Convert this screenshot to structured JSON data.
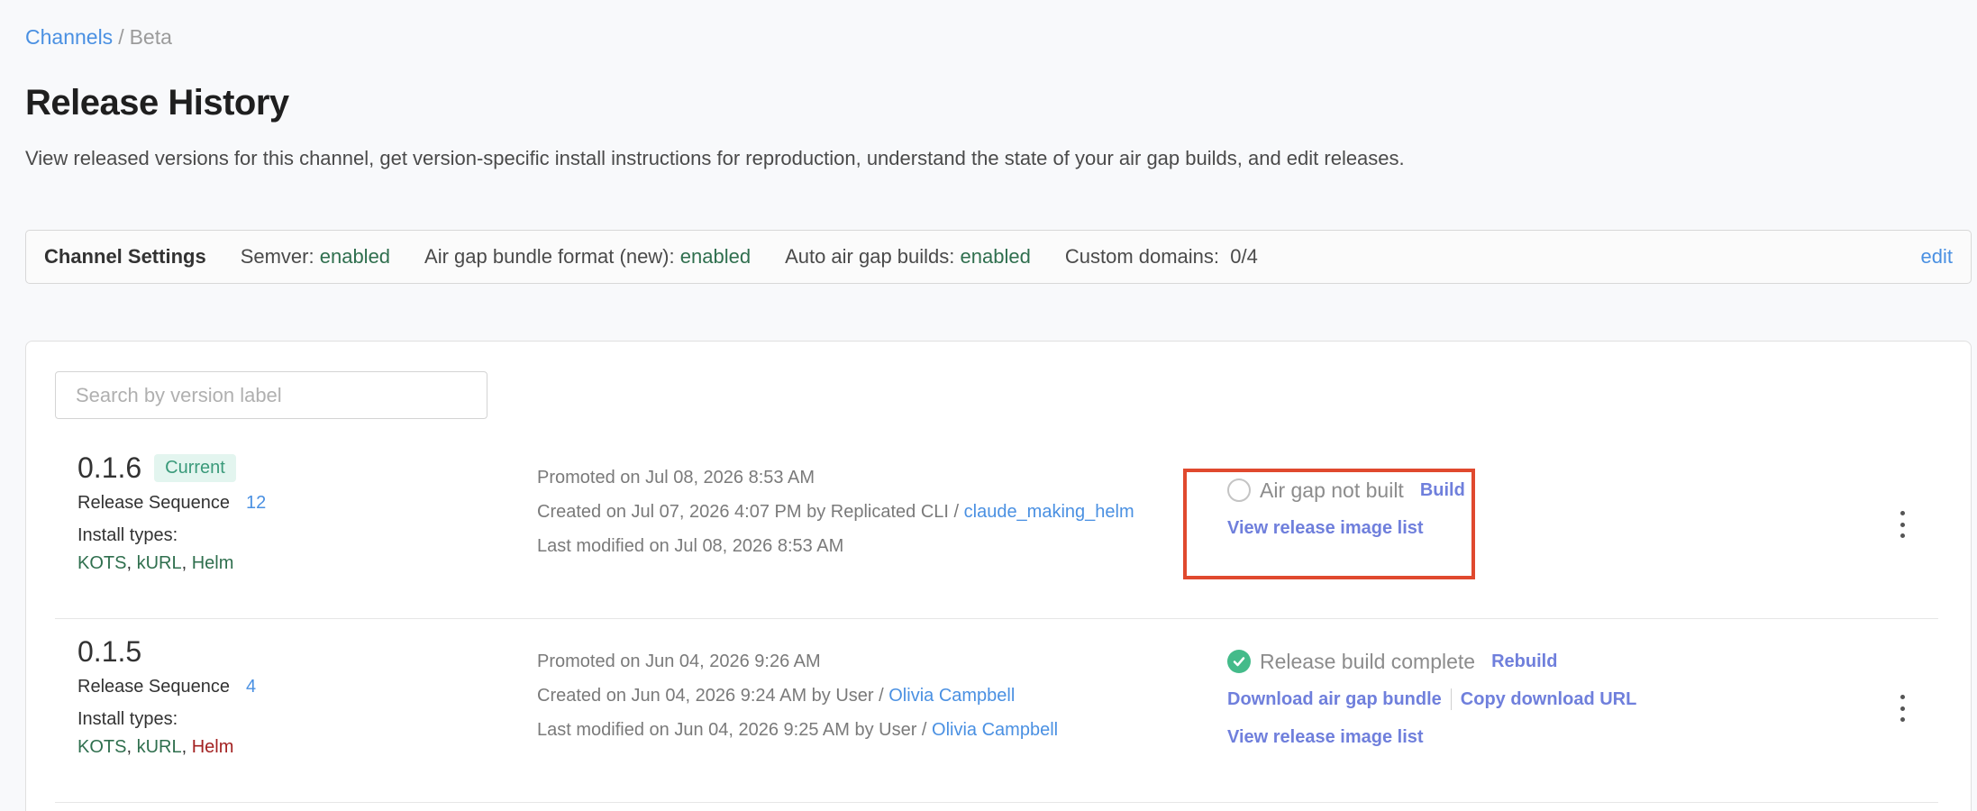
{
  "breadcrumb": {
    "parent": "Channels",
    "separator": "/",
    "current": "Beta"
  },
  "page": {
    "title": "Release History",
    "description": "View released versions for this channel, get version-specific install instructions for reproduction, understand the state of your air gap builds, and edit releases."
  },
  "channel_settings": {
    "title": "Channel Settings",
    "semver_label": "Semver:",
    "semver_value": "enabled",
    "bundle_label": "Air gap bundle format (new):",
    "bundle_value": "enabled",
    "auto_label": "Auto air gap builds:",
    "auto_value": "enabled",
    "domains_label": "Custom domains:",
    "domains_value": "0/4",
    "edit_label": "edit"
  },
  "search": {
    "placeholder": "Search by version label",
    "value": ""
  },
  "releases": [
    {
      "version": "0.1.6",
      "badge": "Current",
      "sequence_label": "Release Sequence",
      "sequence": "12",
      "install_label": "Install types:",
      "install_types": [
        "KOTS",
        "kURL",
        "Helm"
      ],
      "promoted": "Promoted on Jul 08, 2026 8:53 AM",
      "created": "Created on Jul 07, 2026 4:07 PM by Replicated CLI /",
      "created_by": "claude_making_helm",
      "modified": "Last modified on Jul 08, 2026 8:53 AM",
      "status": "Air gap not built",
      "status_action": "Build",
      "image_list_link": "View release image list"
    },
    {
      "version": "0.1.5",
      "sequence_label": "Release Sequence",
      "sequence": "4",
      "install_label": "Install types:",
      "install_types": [
        "KOTS",
        "kURL",
        "Helm"
      ],
      "promoted": "Promoted on Jun 04, 2026 9:26 AM",
      "created": "Created on Jun 04, 2026 9:24 AM by User /",
      "created_by": "Olivia Campbell",
      "modified": "Last modified on Jun 04, 2026 9:25 AM by User /",
      "modified_by": "Olivia Campbell",
      "status": "Release build complete",
      "status_action": "Rebuild",
      "download_link": "Download air gap bundle",
      "copy_link": "Copy download URL",
      "image_list_link": "View release image list"
    }
  ],
  "icons": {
    "not_built": "empty-circle-icon",
    "complete": "check-circle-icon",
    "menu": "kebab-menu-icon"
  },
  "colors": {
    "link": "#4a90e2",
    "enabled": "#2f6f4e",
    "action": "#6f7fdc",
    "highlight": "#e0492e",
    "success": "#44bb8a",
    "helm_red": "#a32121"
  }
}
